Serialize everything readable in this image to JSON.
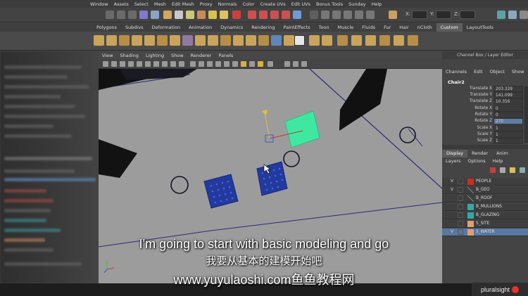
{
  "menubar": {
    "items": [
      "Window",
      "Assets",
      "Select",
      "Mesh",
      "Edit Mesh",
      "Proxy",
      "Normals",
      "Color",
      "Create UVs",
      "Edit UVs",
      "Bonus Tools",
      "Sunday",
      "Help"
    ]
  },
  "statusline": {
    "x_label": "X:",
    "y_label": "Y:",
    "z_label": "Z:"
  },
  "shelf": {
    "tabs": [
      "Polygons",
      "Subdivs",
      "Deformation",
      "Animation",
      "Dynamics",
      "Rendering",
      "PaintEffects",
      "Toon",
      "Muscle",
      "Fluids",
      "Fur",
      "Hair",
      "nCloth",
      "Custom",
      "LayoutTools"
    ],
    "active_tab": "Custom"
  },
  "panel": {
    "menu": [
      "View",
      "Shading",
      "Lighting",
      "Show",
      "Renderer",
      "Panels"
    ]
  },
  "channel_box": {
    "title": "Channel Box / Layer Editor",
    "menu": [
      "Channels",
      "Edit",
      "Object",
      "Show"
    ],
    "object_name": "Chair2",
    "attributes": [
      {
        "label": "Translate X",
        "value": "203.329"
      },
      {
        "label": "Translate Y",
        "value": "141.099"
      },
      {
        "label": "Translate Z",
        "value": "10.356"
      },
      {
        "label": "Rotate X",
        "value": "0"
      },
      {
        "label": "Rotate Y",
        "value": "0"
      },
      {
        "label": "Rotate Z",
        "value": "270"
      },
      {
        "label": "Scale X",
        "value": "1"
      },
      {
        "label": "Scale Y",
        "value": "1"
      },
      {
        "label": "Scale Z",
        "value": "1"
      }
    ]
  },
  "layer_editor": {
    "tabs": [
      "Display",
      "Render",
      "Anim"
    ],
    "active_tab": "Display",
    "menu": [
      "Layers",
      "Options",
      "Help"
    ],
    "layers": [
      {
        "visible": "V",
        "name": "PEOPLE",
        "color": "#d12c1c",
        "selected": false
      },
      {
        "visible": "V",
        "name": "B_GEO",
        "color": "#4d4d4d",
        "selected": false
      },
      {
        "visible": "",
        "name": "B_ROOF",
        "color": "#4d4d4d",
        "selected": false
      },
      {
        "visible": "",
        "name": "B_MULLIONS",
        "color": "#35a7a8",
        "selected": false
      },
      {
        "visible": "",
        "name": "B_GLAZING",
        "color": "#35a7a8",
        "selected": false
      },
      {
        "visible": "",
        "name": "S_SITE",
        "color": "#e0a06e",
        "selected": false
      },
      {
        "visible": "V",
        "name": "S_WATER",
        "color": "#e0a06e",
        "selected": true
      }
    ]
  },
  "subtitles": {
    "line1": "I'm going to start with basic modeling and go",
    "line2": "我要从基本的建模开始吧",
    "line3": "www.yuyulaoshi.com鱼鱼教程网"
  },
  "watermark": {
    "brand": "pluralsight"
  },
  "colors": {
    "viewport_bg": "#9c9c9c",
    "selected_object": "#3fe8a0",
    "chair_blue": "#223aa0",
    "selection_highlight": "#5878a3"
  }
}
